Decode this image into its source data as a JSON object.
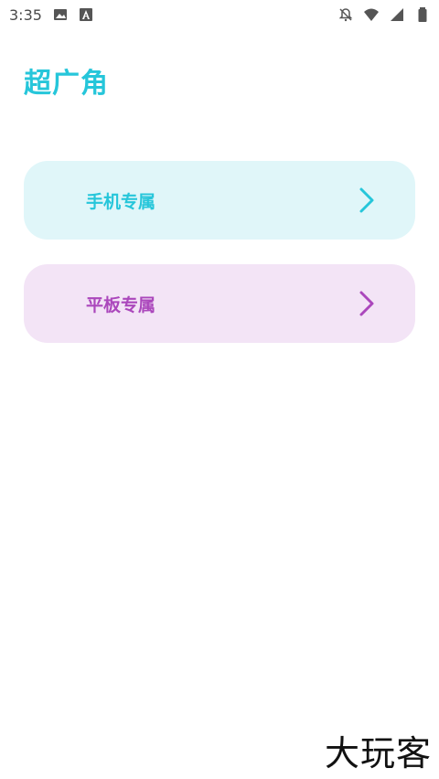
{
  "status_bar": {
    "time": "3:35",
    "icons": [
      "image-icon",
      "a-icon",
      "notifications-off-icon",
      "wifi-icon",
      "signal-icon",
      "battery-icon"
    ]
  },
  "page": {
    "title": "超广角"
  },
  "cards": [
    {
      "label": "手机专属",
      "color": "#26c6da",
      "bg": "#e0f6f9",
      "icon": "chevron-right-icon"
    },
    {
      "label": "平板专属",
      "color": "#ab47bc",
      "bg": "#f3e4f6",
      "icon": "chevron-right-icon"
    }
  ],
  "watermark": {
    "text": "大玩客"
  }
}
